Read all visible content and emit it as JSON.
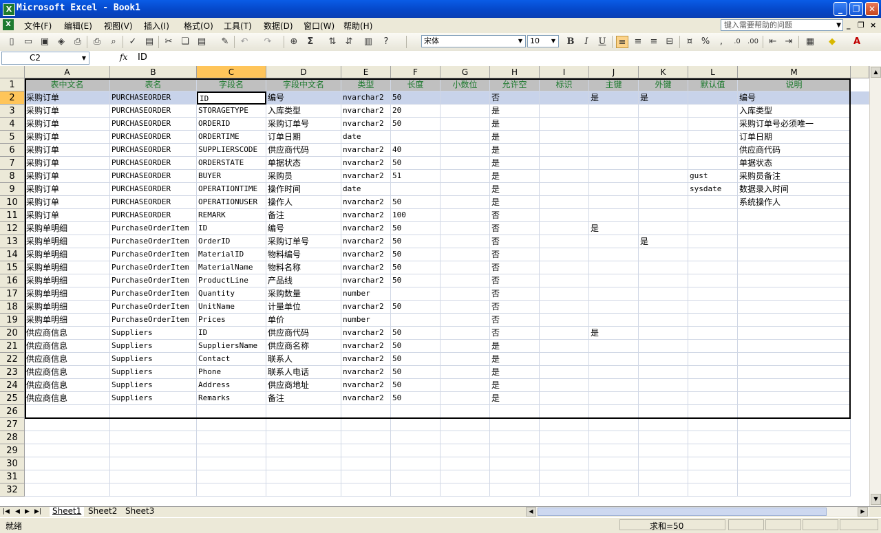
{
  "window": {
    "title": "Microsoft Excel - Book1"
  },
  "menu": [
    "文件(F)",
    "编辑(E)",
    "视图(V)",
    "插入(I)",
    "格式(O)",
    "工具(T)",
    "数据(D)",
    "窗口(W)",
    "帮助(H)"
  ],
  "help_placeholder": "键入需要帮助的问题",
  "font": {
    "name": "宋体",
    "size": "10"
  },
  "name_box": "C2",
  "formula": "ID",
  "columns": [
    "A",
    "B",
    "C",
    "D",
    "E",
    "F",
    "G",
    "H",
    "I",
    "J",
    "K",
    "L",
    "M"
  ],
  "header_row": [
    "表中文名",
    "表名",
    "字段名",
    "字段中文名",
    "类型",
    "长度",
    "小数位",
    "允许空",
    "标识",
    "主键",
    "外键",
    "默认值",
    "说明"
  ],
  "rows": [
    [
      "采购订单",
      "PURCHASEORDER",
      "ID",
      "编号",
      "nvarchar2",
      "50",
      "",
      "否",
      "",
      "是",
      "是",
      "",
      "编号"
    ],
    [
      "采购订单",
      "PURCHASEORDER",
      "STORAGETYPE",
      "入库类型",
      "nvarchar2",
      "20",
      "",
      "是",
      "",
      "",
      "",
      "",
      "入库类型"
    ],
    [
      "采购订单",
      "PURCHASEORDER",
      "ORDERID",
      "采购订单号",
      "nvarchar2",
      "50",
      "",
      "是",
      "",
      "",
      "",
      "",
      "采购订单号必须唯一"
    ],
    [
      "采购订单",
      "PURCHASEORDER",
      "ORDERTIME",
      "订单日期",
      "date",
      "",
      "",
      "是",
      "",
      "",
      "",
      "",
      "订单日期"
    ],
    [
      "采购订单",
      "PURCHASEORDER",
      "SUPPLIERSCODE",
      "供应商代码",
      "nvarchar2",
      "40",
      "",
      "是",
      "",
      "",
      "",
      "",
      "供应商代码"
    ],
    [
      "采购订单",
      "PURCHASEORDER",
      "ORDERSTATE",
      "单据状态",
      "nvarchar2",
      "50",
      "",
      "是",
      "",
      "",
      "",
      "",
      "单据状态"
    ],
    [
      "采购订单",
      "PURCHASEORDER",
      "BUYER",
      "采购员",
      "nvarchar2",
      "51",
      "",
      "是",
      "",
      "",
      "",
      "gust",
      "采购员备注"
    ],
    [
      "采购订单",
      "PURCHASEORDER",
      "OPERATIONTIME",
      "操作时间",
      "date",
      "",
      "",
      "是",
      "",
      "",
      "",
      "sysdate",
      "数据录入时间"
    ],
    [
      "采购订单",
      "PURCHASEORDER",
      "OPERATIONUSER",
      "操作人",
      "nvarchar2",
      "50",
      "",
      "是",
      "",
      "",
      "",
      "",
      "系统操作人"
    ],
    [
      "采购订单",
      "PURCHASEORDER",
      "REMARK",
      "备注",
      "nvarchar2",
      "100",
      "",
      "否",
      "",
      "",
      "",
      "",
      ""
    ],
    [
      "采购单明细",
      "PurchaseOrderItem",
      "ID",
      "编号",
      "nvarchar2",
      "50",
      "",
      "否",
      "",
      "是",
      "",
      "",
      ""
    ],
    [
      "采购单明细",
      "PurchaseOrderItem",
      "OrderID",
      "采购订单号",
      "nvarchar2",
      "50",
      "",
      "否",
      "",
      "",
      "是",
      "",
      ""
    ],
    [
      "采购单明细",
      "PurchaseOrderItem",
      "MaterialID",
      "物料编号",
      "nvarchar2",
      "50",
      "",
      "否",
      "",
      "",
      "",
      "",
      ""
    ],
    [
      "采购单明细",
      "PurchaseOrderItem",
      "MaterialName",
      "物料名称",
      "nvarchar2",
      "50",
      "",
      "否",
      "",
      "",
      "",
      "",
      ""
    ],
    [
      "采购单明细",
      "PurchaseOrderItem",
      "ProductLine",
      "产品线",
      "nvarchar2",
      "50",
      "",
      "否",
      "",
      "",
      "",
      "",
      ""
    ],
    [
      "采购单明细",
      "PurchaseOrderItem",
      "Quantity",
      "采购数量",
      "number",
      "",
      "",
      "否",
      "",
      "",
      "",
      "",
      ""
    ],
    [
      "采购单明细",
      "PurchaseOrderItem",
      "UnitName",
      "计量单位",
      "nvarchar2",
      "50",
      "",
      "否",
      "",
      "",
      "",
      "",
      ""
    ],
    [
      "采购单明细",
      "PurchaseOrderItem",
      "Prices",
      "单价",
      "number",
      "",
      "",
      "否",
      "",
      "",
      "",
      "",
      ""
    ],
    [
      "供应商信息",
      "Suppliers",
      "ID",
      "供应商代码",
      "nvarchar2",
      "50",
      "",
      "否",
      "",
      "是",
      "",
      "",
      ""
    ],
    [
      "供应商信息",
      "Suppliers",
      "SuppliersName",
      "供应商名称",
      "nvarchar2",
      "50",
      "",
      "是",
      "",
      "",
      "",
      "",
      ""
    ],
    [
      "供应商信息",
      "Suppliers",
      "Contact",
      "联系人",
      "nvarchar2",
      "50",
      "",
      "是",
      "",
      "",
      "",
      "",
      ""
    ],
    [
      "供应商信息",
      "Suppliers",
      "Phone",
      "联系人电话",
      "nvarchar2",
      "50",
      "",
      "是",
      "",
      "",
      "",
      "",
      ""
    ],
    [
      "供应商信息",
      "Suppliers",
      "Address",
      "供应商地址",
      "nvarchar2",
      "50",
      "",
      "是",
      "",
      "",
      "",
      "",
      ""
    ],
    [
      "供应商信息",
      "Suppliers",
      "Remarks",
      "备注",
      "nvarchar2",
      "50",
      "",
      "是",
      "",
      "",
      "",
      "",
      ""
    ],
    [
      "",
      "",
      "",
      "",
      "",
      "",
      "",
      "",
      "",
      "",
      "",
      "",
      ""
    ],
    [
      "",
      "",
      "",
      "",
      "",
      "",
      "",
      "",
      "",
      "",
      "",
      "",
      ""
    ],
    [
      "",
      "",
      "",
      "",
      "",
      "",
      "",
      "",
      "",
      "",
      "",
      "",
      ""
    ],
    [
      "",
      "",
      "",
      "",
      "",
      "",
      "",
      "",
      "",
      "",
      "",
      "",
      ""
    ],
    [
      "",
      "",
      "",
      "",
      "",
      "",
      "",
      "",
      "",
      "",
      "",
      "",
      ""
    ],
    [
      "",
      "",
      "",
      "",
      "",
      "",
      "",
      "",
      "",
      "",
      "",
      "",
      ""
    ],
    [
      "",
      "",
      "",
      "",
      "",
      "",
      "",
      "",
      "",
      "",
      "",
      "",
      ""
    ]
  ],
  "sheets": [
    "Sheet1",
    "Sheet2",
    "Sheet3"
  ],
  "status": {
    "ready": "就绪",
    "sum": "求和=50"
  },
  "colors": {
    "title_bar": "#0a5ce6",
    "header_text": "#1e7a2e",
    "selection": "#ffc55a",
    "selected_row": "#c8d3ea"
  },
  "icons": [
    "excel-icon",
    "new-icon",
    "open-icon",
    "save-icon",
    "permission-icon",
    "print-icon",
    "print-preview-icon",
    "spelling-icon",
    "research-icon",
    "cut-icon",
    "copy-icon",
    "paste-icon",
    "format-painter-icon",
    "undo-icon",
    "redo-icon",
    "hyperlink-icon",
    "autosum-icon",
    "sort-ascending-icon",
    "sort-descending-icon",
    "chart-wizard-icon",
    "help-icon",
    "bold-icon",
    "italic-icon",
    "underline-icon",
    "align-left-icon",
    "align-center-icon",
    "align-right-icon",
    "merge-center-icon",
    "currency-icon",
    "percent-icon",
    "comma-icon",
    "increase-decimal-icon",
    "decrease-decimal-icon",
    "decrease-indent-icon",
    "increase-indent-icon",
    "borders-icon",
    "fill-color-icon",
    "font-color-icon"
  ]
}
